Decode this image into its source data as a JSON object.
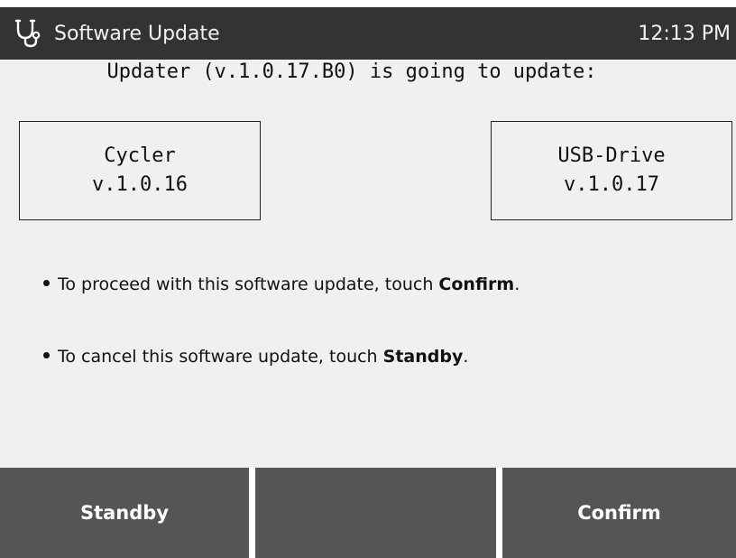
{
  "header": {
    "icon": "stethoscope-icon",
    "title": "Software Update",
    "time": "12:13 PM"
  },
  "main": {
    "heading": "Updater (v.1.0.17.B0) is going to update:",
    "from_box": {
      "name": "Cycler",
      "version": "v.1.0.16"
    },
    "to_box": {
      "name": "USB-Drive",
      "version": "v.1.0.17"
    },
    "instructions": [
      {
        "prefix": "To proceed with this software update, touch ",
        "action": "Confirm",
        "suffix": "."
      },
      {
        "prefix": "To cancel this software update, touch ",
        "action": "Standby",
        "suffix": "."
      }
    ]
  },
  "footer": {
    "left_button": "Standby",
    "middle_button": "",
    "right_button": "Confirm"
  },
  "colors": {
    "titlebar": "#333333",
    "background": "#f0f0f0",
    "button": "#555555"
  }
}
